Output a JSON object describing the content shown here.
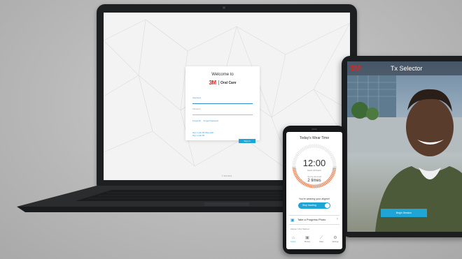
{
  "laptop": {
    "login": {
      "welcome": "Welcome to",
      "logo": "3M",
      "brand": "Oral Care",
      "username_label": "Username",
      "password_label": "Password",
      "forgot_id": "Forgot ID",
      "forgot_password": "Forgot Password",
      "lang_line1": "Sign in with 3M Office ASB",
      "lang_line2": "Sign in with 3M",
      "signin_button": "Sign in"
    },
    "footer": "© 3M 2021"
  },
  "tablet": {
    "logo": "3M",
    "title": "Tx Selector",
    "button": "Begin Session"
  },
  "phone": {
    "title": "Today's Wear Time",
    "time": "12:00",
    "goal": "Goal: 22 hours",
    "removed_label": "You've removed",
    "removed_count": "2 times",
    "wearing_text": "You're wearing your aligner!",
    "toggle_label": "Stop tracking",
    "photo_label": "Take a Progress Photo",
    "partial_text": "Aligner 1/14 Started",
    "nav": [
      {
        "icon": "home-icon",
        "glyph": "⌂",
        "label": "Home"
      },
      {
        "icon": "photos-icon",
        "glyph": "▣",
        "label": "Photos"
      },
      {
        "icon": "stats-icon",
        "glyph": "⟋",
        "label": "Stats"
      },
      {
        "icon": "settings-icon",
        "glyph": "⚙",
        "label": "Settings"
      }
    ]
  },
  "colors": {
    "brand_red": "#e2231a",
    "accent_blue": "#1fa4d6"
  }
}
